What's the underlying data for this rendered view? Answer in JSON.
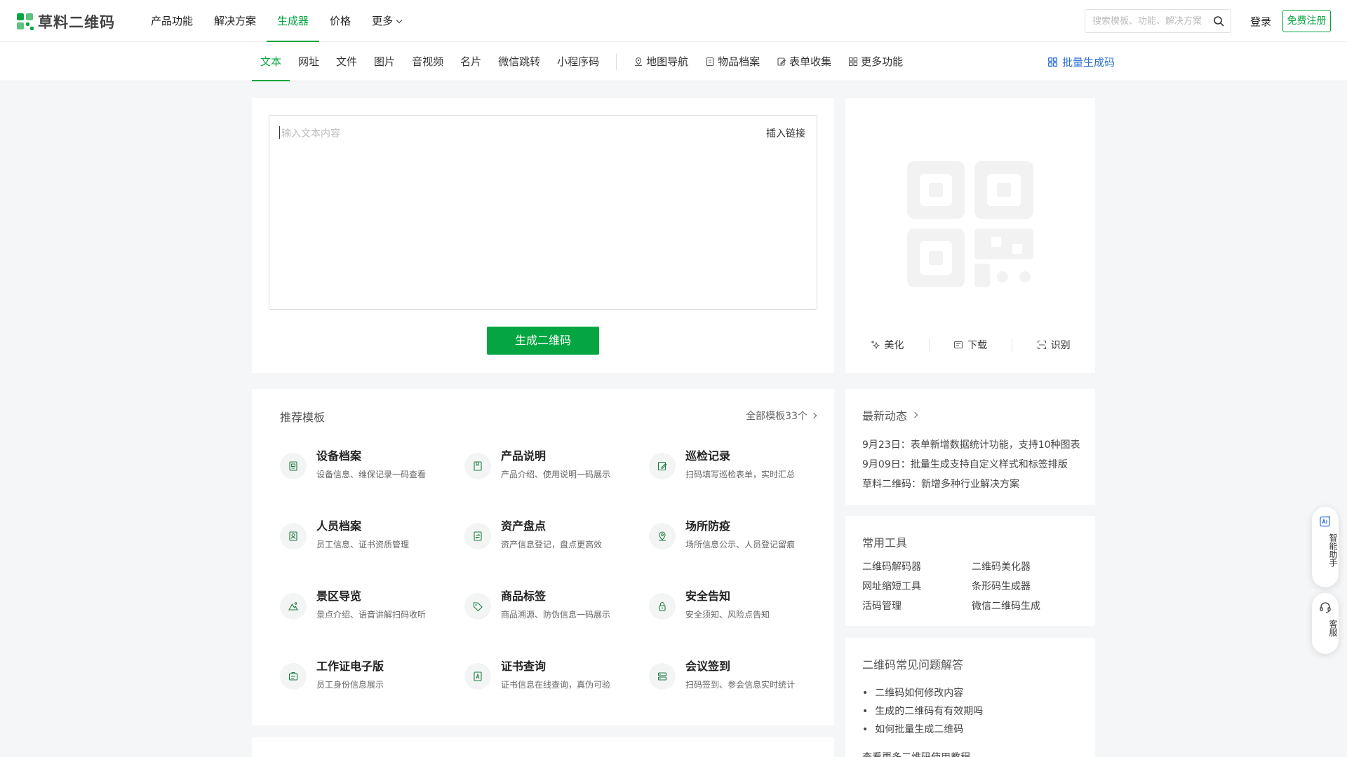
{
  "header": {
    "logo_text": "草料二维码",
    "nav": [
      {
        "label": "产品功能"
      },
      {
        "label": "解决方案"
      },
      {
        "label": "生成器"
      },
      {
        "label": "价格"
      },
      {
        "label": "更多"
      }
    ],
    "search_placeholder": "搜索模板、功能、解决方案",
    "login_label": "登录",
    "register_label": "免费注册"
  },
  "subnav": {
    "tabs": [
      {
        "label": "文本"
      },
      {
        "label": "网址"
      },
      {
        "label": "文件"
      },
      {
        "label": "图片"
      },
      {
        "label": "音视频"
      },
      {
        "label": "名片"
      },
      {
        "label": "微信跳转"
      },
      {
        "label": "小程序码"
      }
    ],
    "special_tabs": [
      {
        "label": "地图导航",
        "icon": "map-pin-icon"
      },
      {
        "label": "物品档案",
        "icon": "archive-icon"
      },
      {
        "label": "表单收集",
        "icon": "form-edit-icon"
      },
      {
        "label": "更多功能",
        "icon": "grid-icon"
      }
    ],
    "batch_label": "批量生成码"
  },
  "editor": {
    "placeholder": "输入文本内容",
    "link_label": "插入链接",
    "generate_label": "生成二维码"
  },
  "qr_panel": {
    "actions": [
      {
        "label": "美化",
        "icon": "sparkle-icon"
      },
      {
        "label": "下载",
        "icon": "image-icon"
      },
      {
        "label": "识别",
        "icon": "scan-icon"
      }
    ]
  },
  "templates": {
    "title": "推荐模板",
    "all_label": "全部模板33个",
    "items": [
      {
        "name": "设备档案",
        "desc": "设备信息、维保记录一码查看",
        "icon": "device-doc-icon"
      },
      {
        "name": "产品说明",
        "desc": "产品介绍、使用说明一码展示",
        "icon": "book-icon"
      },
      {
        "name": "巡检记录",
        "desc": "扫码填写巡检表单，实时汇总",
        "icon": "edit-doc-icon"
      },
      {
        "name": "人员档案",
        "desc": "员工信息、证书资质管理",
        "icon": "person-doc-icon"
      },
      {
        "name": "资产盘点",
        "desc": "资产信息登记，盘点更高效",
        "icon": "swap-doc-icon"
      },
      {
        "name": "场所防疫",
        "desc": "场所信息公示、人员登记留痕",
        "icon": "location-icon"
      },
      {
        "name": "景区导览",
        "desc": "景点介绍、语音讲解扫码收听",
        "icon": "mountain-icon"
      },
      {
        "name": "商品标签",
        "desc": "商品溯源、防伪信息一码展示",
        "icon": "tag-icon"
      },
      {
        "name": "安全告知",
        "desc": "安全须知、风险点告知",
        "icon": "lock-icon"
      },
      {
        "name": "工作证电子版",
        "desc": "员工身份信息展示",
        "icon": "badge-icon"
      },
      {
        "name": "证书查询",
        "desc": "证书信息在线查询，真伪可验",
        "icon": "certificate-icon"
      },
      {
        "name": "会议签到",
        "desc": "扫码签到、参会信息实时统计",
        "icon": "people-icon"
      }
    ]
  },
  "news": {
    "title": "最新动态",
    "items": [
      "9月23日：表单新增数据统计功能，支持10种图表",
      "9月09日：批量生成支持自定义样式和标签排版",
      "草料二维码：新增多种行业解决方案"
    ]
  },
  "tools": {
    "title": "常用工具",
    "items": [
      "二维码解码器",
      "二维码美化器",
      "网址缩短工具",
      "条形码生成器",
      "活码管理",
      "微信二维码生成"
    ]
  },
  "faq": {
    "title": "二维码常见问题解答",
    "items": [
      "二维码如何修改内容",
      "生成的二维码有有效期吗",
      "如何批量生成二维码"
    ],
    "more": "查看更多二维码使用教程"
  },
  "floating": {
    "ai_label": "智能助手",
    "cs_label": "客服"
  },
  "colors": {
    "brand": "#05a641",
    "link_blue": "#2b6ed6"
  }
}
